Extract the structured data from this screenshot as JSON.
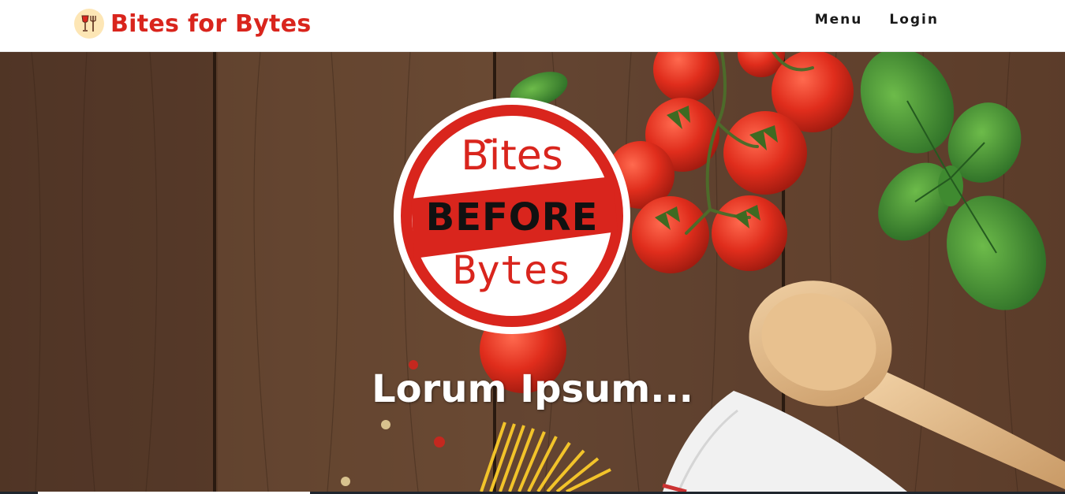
{
  "navbar": {
    "brand_name": "Bites for Bytes",
    "brand_icon": "wine-and-fork-icon",
    "links": [
      {
        "label": "Menu"
      },
      {
        "label": "Login"
      }
    ]
  },
  "hero": {
    "logo": {
      "word_top": "Bites",
      "word_middle": "BEFORE",
      "word_bottom": "Bytes"
    },
    "heading": "Lorum Ipsum..."
  },
  "colors": {
    "brand_red": "#d9251d",
    "wood": "#5b3d2a",
    "tomato": "#d8281a",
    "basil": "#2f7d2b"
  }
}
